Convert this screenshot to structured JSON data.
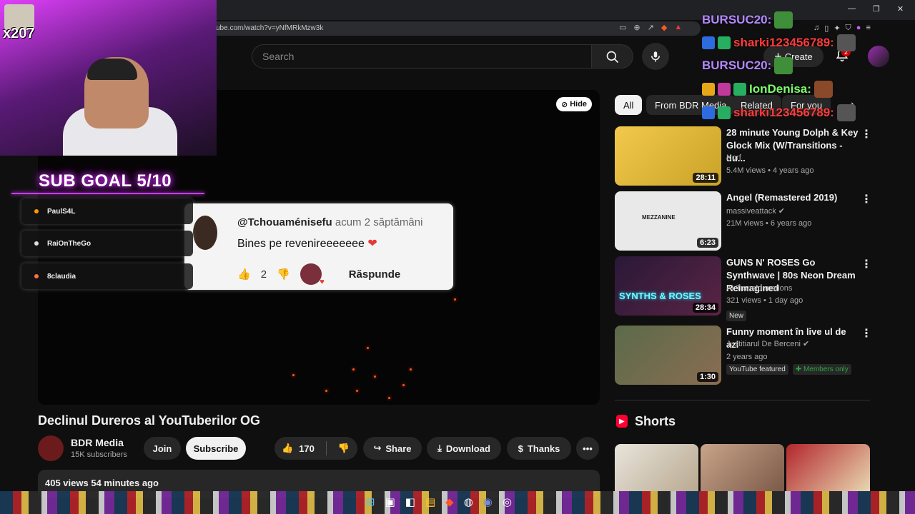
{
  "browser": {
    "url": "ube.com/watch?v=yNfMRkMzw3k"
  },
  "header": {
    "search_placeholder": "Search",
    "create_label": "Create",
    "notifications_count": "2"
  },
  "player": {
    "hide_label": "Hide"
  },
  "comment_overlay": {
    "author": "@Tchouaménisefu",
    "time": "acum 2 săptămâni",
    "text": "Bines pe revenireeeeeee",
    "likes": "2",
    "reply_label": "Răspunde"
  },
  "stream_overlay": {
    "counter": "x207",
    "sub_goal": "SUB GOAL 5/10",
    "subs": [
      "PaulS4L",
      "RaiOnTheGo",
      "8claudia"
    ]
  },
  "chips": [
    {
      "label": "All",
      "active": true
    },
    {
      "label": "From BDR Media"
    },
    {
      "label": "Related"
    },
    {
      "label": "For you"
    }
  ],
  "recommended": [
    {
      "title": "28 minute Young Dolph & Key Glock Mix (W/Transitions - du...",
      "channel": "Norf",
      "meta": "5.4M views • 4 years ago",
      "duration": "28:11"
    },
    {
      "title": "Angel (Remastered 2019)",
      "channel": "massiveattack",
      "meta": "21M views • 6 years ago",
      "duration": "6:23",
      "thumb_text": "MEZZANINE"
    },
    {
      "title": "GUNS N' ROSES Go Synthwave | 80s Neon Dream Reimagined",
      "channel": "AI Transformations",
      "meta": "321 views • 1 day ago",
      "duration": "28:34",
      "tag": "New",
      "thumb_text": "SYNTHS & ROSES"
    },
    {
      "title": "Funny moment în live ul de azi",
      "channel": "Justitiarul De Berceni",
      "meta": "2 years ago",
      "duration": "1:30",
      "tag": "YouTube featured",
      "tag2": "Members only"
    }
  ],
  "video": {
    "title": "Declinul Dureros al YouTuberilor OG",
    "channel": "BDR Media",
    "subscribers": "15K subscribers",
    "join_label": "Join",
    "subscribe_label": "Subscribe",
    "likes": "170",
    "share_label": "Share",
    "download_label": "Download",
    "thanks_label": "Thanks",
    "views": "405 views",
    "date": "54 minutes ago"
  },
  "shorts": {
    "title": "Shorts"
  },
  "chat": [
    {
      "user": "BURSUC20:",
      "color": "#b388ff"
    },
    {
      "user": "sharki123456789:",
      "color": "#ff3b3b"
    },
    {
      "user": "BURSUC20:",
      "color": "#b388ff"
    },
    {
      "user": "IonDenisa:",
      "color": "#7dff6a"
    },
    {
      "user": "sharki123456789:",
      "color": "#ff3b3b"
    }
  ],
  "colors": {
    "accent_red": "#ff0033",
    "sub_glow": "#e040fb",
    "members_green": "#2ba640"
  }
}
